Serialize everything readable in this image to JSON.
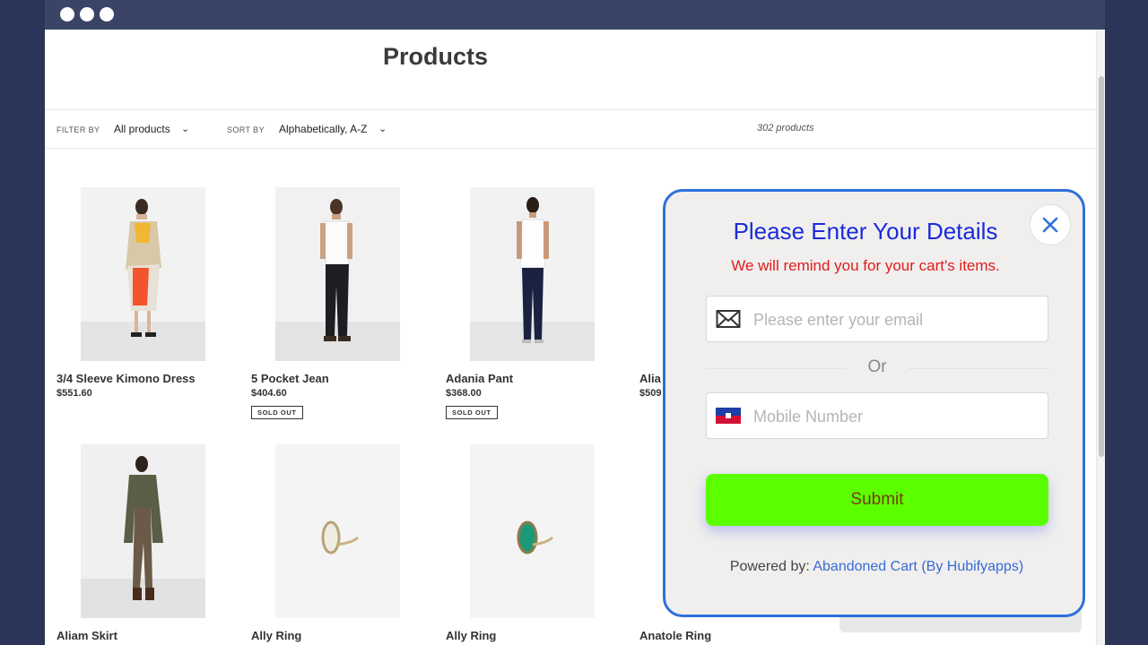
{
  "window": {
    "controls": [
      "close",
      "minimize",
      "maximize"
    ]
  },
  "page": {
    "title": "Products",
    "filter": {
      "label": "FILTER BY",
      "value": "All products"
    },
    "sort": {
      "label": "SORT BY",
      "value": "Alphabetically, A-Z"
    },
    "count": "302 products"
  },
  "products": [
    {
      "name": "3/4 Sleeve Kimono Dress",
      "price": "$551.60",
      "badge": ""
    },
    {
      "name": "5 Pocket Jean",
      "price": "$404.60",
      "badge": "SOLD OUT"
    },
    {
      "name": "Adania Pant",
      "price": "$368.00",
      "badge": "SOLD OUT"
    },
    {
      "name": "Alia",
      "price": "$509",
      "badge": ""
    },
    {
      "name": "Aliam Skirt",
      "price": "",
      "badge": ""
    },
    {
      "name": "Ally Ring",
      "price": "",
      "badge": ""
    },
    {
      "name": "Ally Ring",
      "price": "",
      "badge": ""
    },
    {
      "name": "Anatole Ring",
      "price": "",
      "badge": ""
    }
  ],
  "modal": {
    "title": "Please Enter Your Details",
    "subtitle": "We will remind you for your cart's items.",
    "email_placeholder": "Please enter your email",
    "or_text": "Or",
    "phone_placeholder": "Mobile Number",
    "submit_label": "Submit",
    "powered_prefix": "Powered by:",
    "powered_link": "Abandoned Cart (By Hubifyapps)",
    "colors": {
      "border": "#2f6fdc",
      "title": "#1a2bd8",
      "subtitle": "#e21b1b",
      "submit_bg": "#5cff00"
    }
  }
}
